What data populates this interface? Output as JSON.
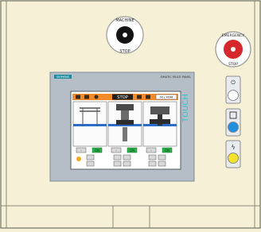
{
  "cabinet": {
    "background": "#f6f1d6",
    "frame_color": "#8a8a7a"
  },
  "machine_stop": {
    "label_top": "MACHINE",
    "label_bottom": "STOP"
  },
  "emergency_stop": {
    "label_top": "EMERGENCY",
    "label_bottom": "STOP",
    "cap_color": "#d6272d"
  },
  "side_buttons": [
    {
      "name": "power-off",
      "glyph": "0\n|",
      "icon": "power-icon",
      "color": "#ffffff"
    },
    {
      "name": "reset",
      "glyph": "⊡",
      "icon": "reset-icon",
      "color": "#1f8fe0"
    },
    {
      "name": "fault-reset",
      "glyph": "⚡",
      "icon": "fault-icon",
      "color": "#f5e22c"
    }
  ],
  "hmi": {
    "brand": "SIEMENS",
    "model": "SIMATIC MULTI PANEL",
    "side_text": "TOUCH",
    "bezel_color": "#b5bec6",
    "toolbar": {
      "status": "STOP",
      "display": "00 / 4096",
      "icons": [
        "home-icon",
        "settings-icon",
        "tools-icon",
        "lock-icon"
      ]
    },
    "station_buttons": [
      "-",
      "ON",
      "-",
      "ON",
      "-",
      "ON"
    ]
  }
}
